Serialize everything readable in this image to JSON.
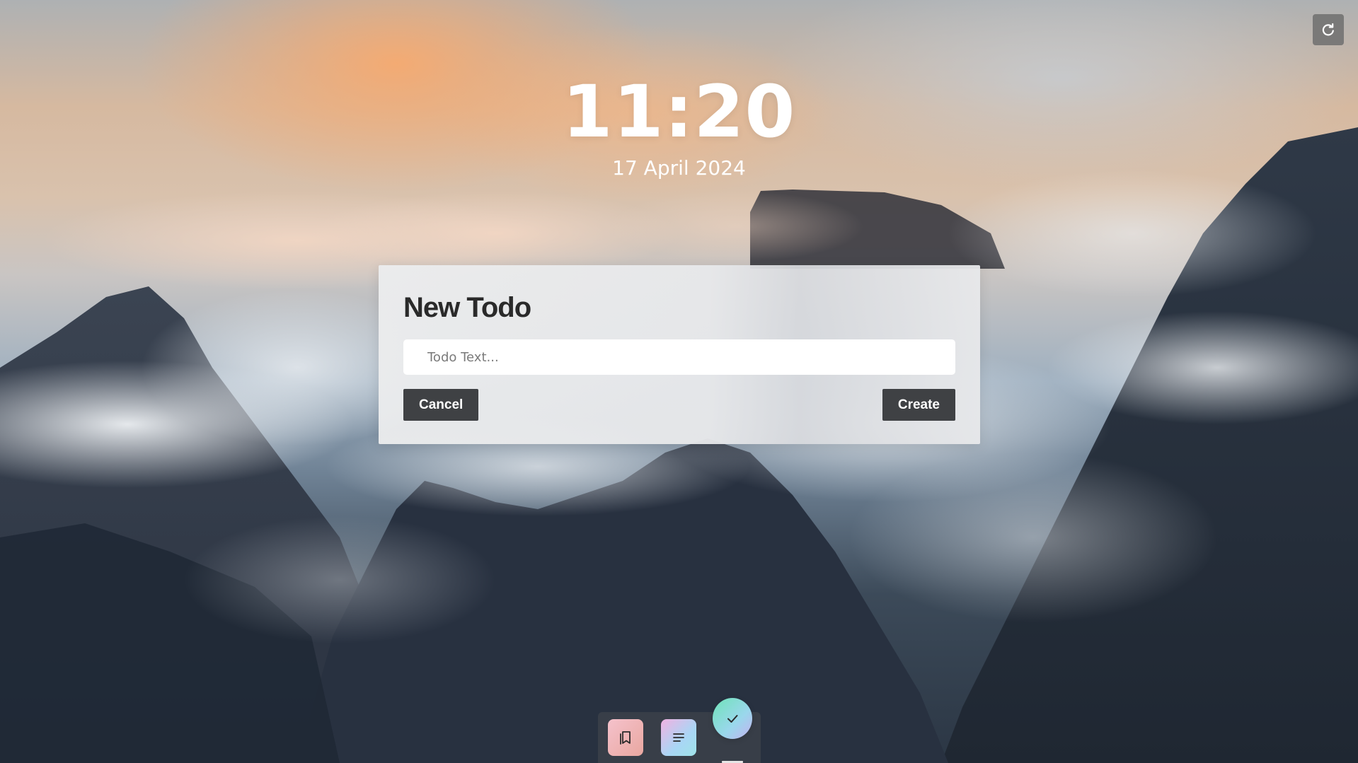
{
  "clock": {
    "time": "11:20",
    "date": "17 April 2024"
  },
  "toolbar": {
    "refresh_icon": "refresh-icon"
  },
  "dialog": {
    "title": "New Todo",
    "input": {
      "placeholder": "Todo Text...",
      "value": ""
    },
    "cancel_label": "Cancel",
    "create_label": "Create"
  },
  "dock": {
    "apps": [
      {
        "name": "bookmarks",
        "icon": "bookmark-icon",
        "colors": [
          "#f5c2cc",
          "#e9a7a0"
        ]
      },
      {
        "name": "notes",
        "icon": "lines-icon",
        "colors": [
          "#f1b2e2",
          "#9fe3e8"
        ]
      },
      {
        "name": "todo",
        "icon": "check-icon",
        "colors": [
          "#6fe3b8",
          "#c5b2f0"
        ],
        "active": true
      }
    ]
  },
  "colors": {
    "button_bg": "#3f4144",
    "dialog_bg": "#e9eaeb",
    "accent_sky": "#f6aa70"
  }
}
